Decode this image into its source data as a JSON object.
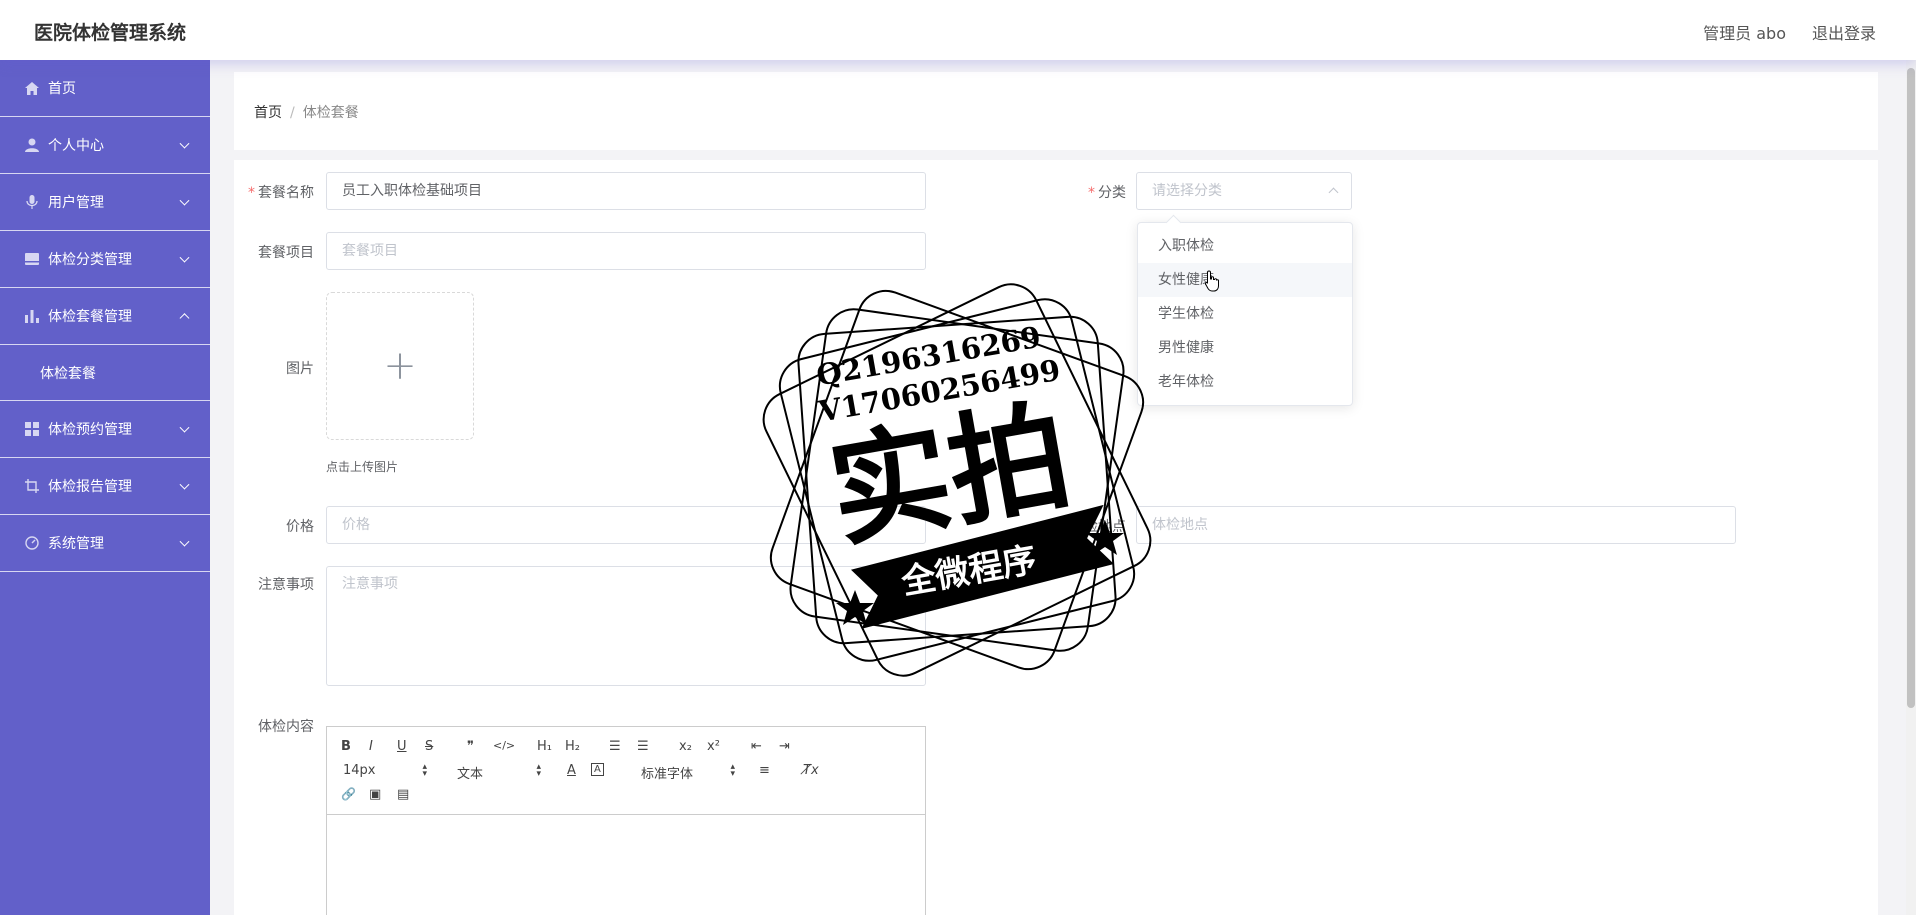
{
  "header": {
    "title": "医院体检管理系统",
    "user": "管理员 abo",
    "logout": "退出登录"
  },
  "sidebar": {
    "items": [
      {
        "label": "首页",
        "icon": "home-icon"
      },
      {
        "label": "个人中心",
        "icon": "user-icon"
      },
      {
        "label": "用户管理",
        "icon": "mic-icon"
      },
      {
        "label": "体检分类管理",
        "icon": "folder-icon"
      },
      {
        "label": "体检套餐管理",
        "icon": "bar-chart-icon"
      },
      {
        "label": "体检预约管理",
        "icon": "grid-icon"
      },
      {
        "label": "体检报告管理",
        "icon": "crop-icon"
      },
      {
        "label": "系统管理",
        "icon": "gauge-icon"
      }
    ],
    "sub_item": "体检套餐"
  },
  "breadcrumb": {
    "home": "首页",
    "separator": "/",
    "current": "体检套餐"
  },
  "form": {
    "name_label": "套餐名称",
    "name_value": "员工入职体检基础项目",
    "category_label": "分类",
    "category_placeholder": "请选择分类",
    "items_label": "套餐项目",
    "items_placeholder": "套餐项目",
    "image_label": "图片",
    "upload_plus": "+",
    "upload_tip": "点击上传图片",
    "price_label": "价格",
    "price_placeholder": "价格",
    "location_label": "体检地点",
    "location_placeholder": "体检地点",
    "notes_label": "注意事项",
    "notes_placeholder": "注意事项",
    "content_label": "体检内容"
  },
  "dropdown": {
    "options": [
      "入职体检",
      "女性健康",
      "学生体检",
      "男性健康",
      "老年体检"
    ],
    "hovered_index": 1
  },
  "editor": {
    "bold": "B",
    "italic": "I",
    "underline": "U",
    "strike": "S",
    "quote": "❞",
    "code": "</>",
    "h1": "H₁",
    "h2": "H₂",
    "ordered_list": "☰",
    "bullet_list": "☰",
    "subscript": "x₂",
    "superscript": "x²",
    "outdent": "⇤",
    "indent": "⇥",
    "size": "14px",
    "header": "文本",
    "color": "A",
    "background": "A",
    "font": "标准字体",
    "align": "≡",
    "clean": "T̸x",
    "link": "🔗",
    "image": "▣",
    "video": "▤"
  },
  "watermark": {
    "line1": "Q2196316269",
    "line2": "V17060256499",
    "big": "实拍",
    "banner": "全微程序"
  },
  "colors": {
    "sidebar": "#6260c9",
    "required": "#f56c6c"
  }
}
